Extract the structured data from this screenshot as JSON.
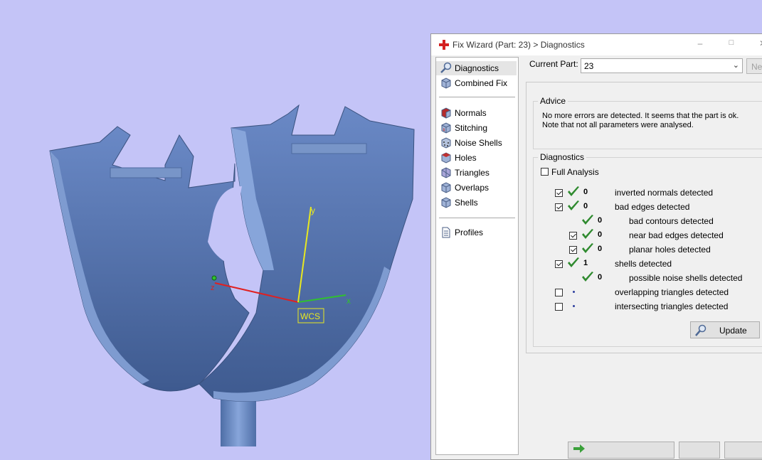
{
  "window": {
    "title": "Fix Wizard (Part: 23) > Diagnostics",
    "minimize_icon": "minimize-icon",
    "maximize_icon": "maximize-icon",
    "close_icon": "close-icon"
  },
  "nav": {
    "items": [
      {
        "label": "Diagnostics",
        "icon": "magnifier-icon",
        "selected": true
      },
      {
        "label": "Combined Fix",
        "icon": "cube-icon"
      },
      {
        "label": "Normals",
        "icon": "red-cube-icon"
      },
      {
        "label": "Stitching",
        "icon": "stitch-cube-icon"
      },
      {
        "label": "Noise Shells",
        "icon": "dotted-cube-icon"
      },
      {
        "label": "Holes",
        "icon": "red-cube-icon"
      },
      {
        "label": "Triangles",
        "icon": "triangle-cube-icon"
      },
      {
        "label": "Overlaps",
        "icon": "overlap-cube-icon"
      },
      {
        "label": "Shells",
        "icon": "cube-icon"
      },
      {
        "label": "Profiles",
        "icon": "document-icon"
      }
    ]
  },
  "current_part": {
    "label": "Current Part:",
    "value": "23",
    "next_label": "Ne"
  },
  "advice": {
    "title": "Advice",
    "text": "No more errors are detected. It seems that the part is ok. Note that not all parameters were analysed."
  },
  "diagnostics": {
    "title": "Diagnostics",
    "full_analysis_label": "Full Analysis",
    "full_analysis_checked": false,
    "rows": [
      {
        "checkbox": true,
        "checked": true,
        "status": "ok",
        "count": "0",
        "text": "inverted normals detected",
        "indent": 0
      },
      {
        "checkbox": true,
        "checked": true,
        "status": "ok",
        "count": "0",
        "text": "bad edges detected",
        "indent": 0
      },
      {
        "checkbox": false,
        "checked": false,
        "status": "ok",
        "count": "0",
        "text": "bad contours detected",
        "indent": 1
      },
      {
        "checkbox": true,
        "checked": true,
        "status": "ok",
        "count": "0",
        "text": "near bad edges detected",
        "indent": 1
      },
      {
        "checkbox": true,
        "checked": true,
        "status": "ok",
        "count": "0",
        "text": "planar holes detected",
        "indent": 1
      },
      {
        "checkbox": true,
        "checked": true,
        "status": "ok",
        "count": "1",
        "text": "shells detected",
        "indent": 0
      },
      {
        "checkbox": false,
        "checked": false,
        "status": "ok",
        "count": "0",
        "text": "possible noise shells detected",
        "indent": 1
      },
      {
        "checkbox": true,
        "checked": false,
        "status": "none",
        "count": "",
        "text": "overlapping triangles detected",
        "indent": 0
      },
      {
        "checkbox": true,
        "checked": false,
        "status": "none",
        "count": "",
        "text": "intersecting triangles detected",
        "indent": 0
      }
    ],
    "update_label": "Update"
  },
  "viewport": {
    "axis_x": "x",
    "axis_y": "y",
    "axis_z": "z",
    "wcs_label": "WCS",
    "model_color": "#5b7ab4",
    "background_color": "#c4c4f7"
  }
}
